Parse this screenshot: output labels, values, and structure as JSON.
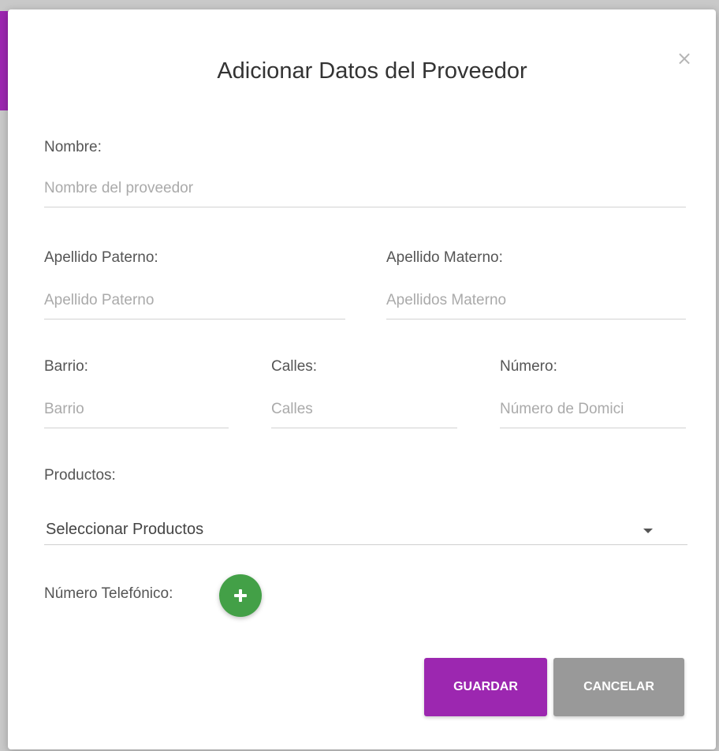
{
  "dialog": {
    "title": "Adicionar Datos del Proveedor",
    "close_glyph": "×"
  },
  "fields": {
    "nombre": {
      "label": "Nombre:",
      "placeholder": "Nombre del proveedor",
      "value": ""
    },
    "apellido_paterno": {
      "label": "Apellido Paterno:",
      "placeholder": "Apellido Paterno",
      "value": ""
    },
    "apellido_materno": {
      "label": "Apellido Materno:",
      "placeholder": "Apellidos Materno",
      "value": ""
    },
    "barrio": {
      "label": "Barrio:",
      "placeholder": "Barrio",
      "value": ""
    },
    "calles": {
      "label": "Calles:",
      "placeholder": "Calles",
      "value": ""
    },
    "numero": {
      "label": "Número:",
      "placeholder": "Número de Domici",
      "value": ""
    }
  },
  "productos": {
    "label": "Productos:",
    "selected": "Seleccionar Productos"
  },
  "telefono": {
    "label": "Número Telefónico:",
    "add_icon": "plus-icon"
  },
  "actions": {
    "save_label": "GUARDAR",
    "cancel_label": "CANCELAR"
  },
  "colors": {
    "primary": "#9c27b0",
    "success": "#43a047",
    "neutral_button": "#999999"
  }
}
